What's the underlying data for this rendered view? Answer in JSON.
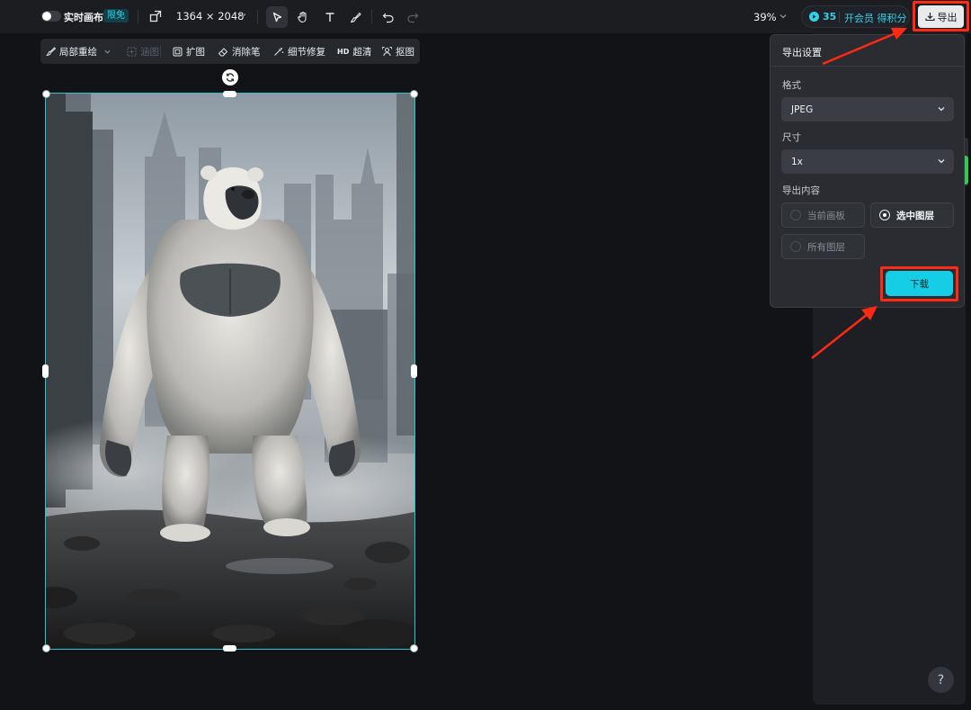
{
  "topbar": {
    "realtime_label": "实时画布",
    "free_badge": "限免",
    "canvas_size": "1364 × 2048",
    "zoom": "39%",
    "credits_count": "35",
    "credits_text": "开会员 得积分",
    "export_label": "导出"
  },
  "subtoolbar": {
    "items": [
      {
        "label": "局部重绘",
        "icon": "brush-icon",
        "enabled": true
      },
      {
        "label": "涵图",
        "icon": "frame-icon",
        "enabled": false
      },
      {
        "label": "扩图",
        "icon": "expand-icon",
        "enabled": true
      },
      {
        "label": "消除笔",
        "icon": "eraser-icon",
        "enabled": true
      },
      {
        "label": "细节修复",
        "icon": "magic-wand-icon",
        "enabled": true
      },
      {
        "label": "超清",
        "icon": "hd-icon",
        "badge": "HD",
        "enabled": true
      },
      {
        "label": "抠图",
        "icon": "cutout-icon",
        "enabled": true
      }
    ]
  },
  "export_panel": {
    "title": "导出设置",
    "format_label": "格式",
    "format_value": "JPEG",
    "size_label": "尺寸",
    "size_value": "1x",
    "content_label": "导出内容",
    "options": [
      {
        "label": "当前画板",
        "selected": false
      },
      {
        "label": "选中图层",
        "selected": true
      },
      {
        "label": "所有图层",
        "selected": false
      }
    ],
    "download_label": "下载"
  },
  "help_label": "?",
  "colors": {
    "accent": "#16cde6",
    "highlight": "#ff2a14",
    "selection": "#27c7d6"
  }
}
